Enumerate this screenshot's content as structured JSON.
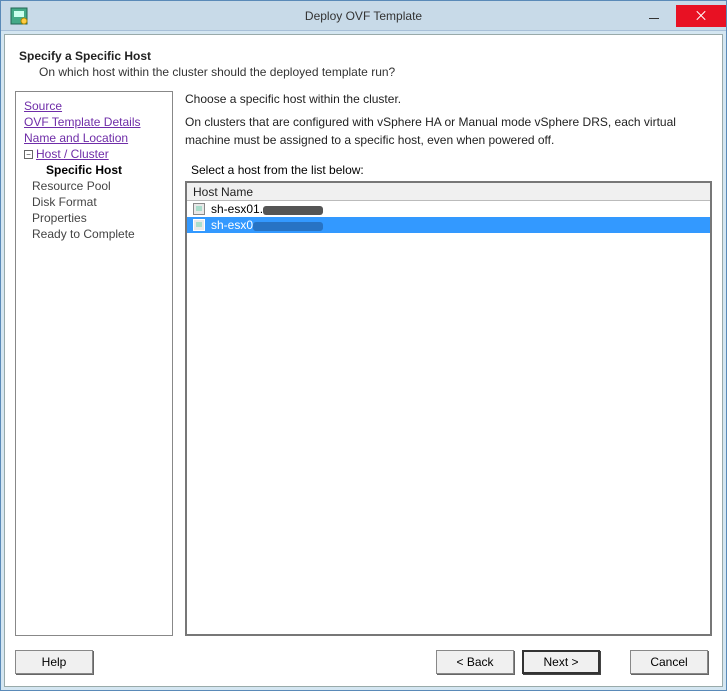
{
  "window": {
    "title": "Deploy OVF Template"
  },
  "header": {
    "title": "Specify a Specific Host",
    "subtitle": "On which host within the cluster should the deployed template run?"
  },
  "sidebar": {
    "items": [
      {
        "label": "Source",
        "type": "link"
      },
      {
        "label": "OVF Template Details",
        "type": "link"
      },
      {
        "label": "Name and Location",
        "type": "link"
      },
      {
        "label": "Host / Cluster",
        "type": "tree-link"
      },
      {
        "label": "Specific Host",
        "type": "current"
      },
      {
        "label": "Resource Pool",
        "type": "disabled"
      },
      {
        "label": "Disk Format",
        "type": "disabled"
      },
      {
        "label": "Properties",
        "type": "disabled"
      },
      {
        "label": "Ready to Complete",
        "type": "disabled"
      }
    ]
  },
  "main": {
    "intro1": "Choose a specific host within the cluster.",
    "intro2": "On clusters that are configured with vSphere HA or Manual mode vSphere DRS, each virtual machine must be assigned to a specific host, even when powered off.",
    "list_label": "Select a host from the list below:",
    "column_header": "Host Name",
    "hosts": [
      {
        "name": "sh-esx01.",
        "selected": false
      },
      {
        "name": "sh-esx0",
        "selected": true
      }
    ]
  },
  "footer": {
    "help": "Help",
    "back": "< Back",
    "next": "Next >",
    "cancel": "Cancel"
  }
}
